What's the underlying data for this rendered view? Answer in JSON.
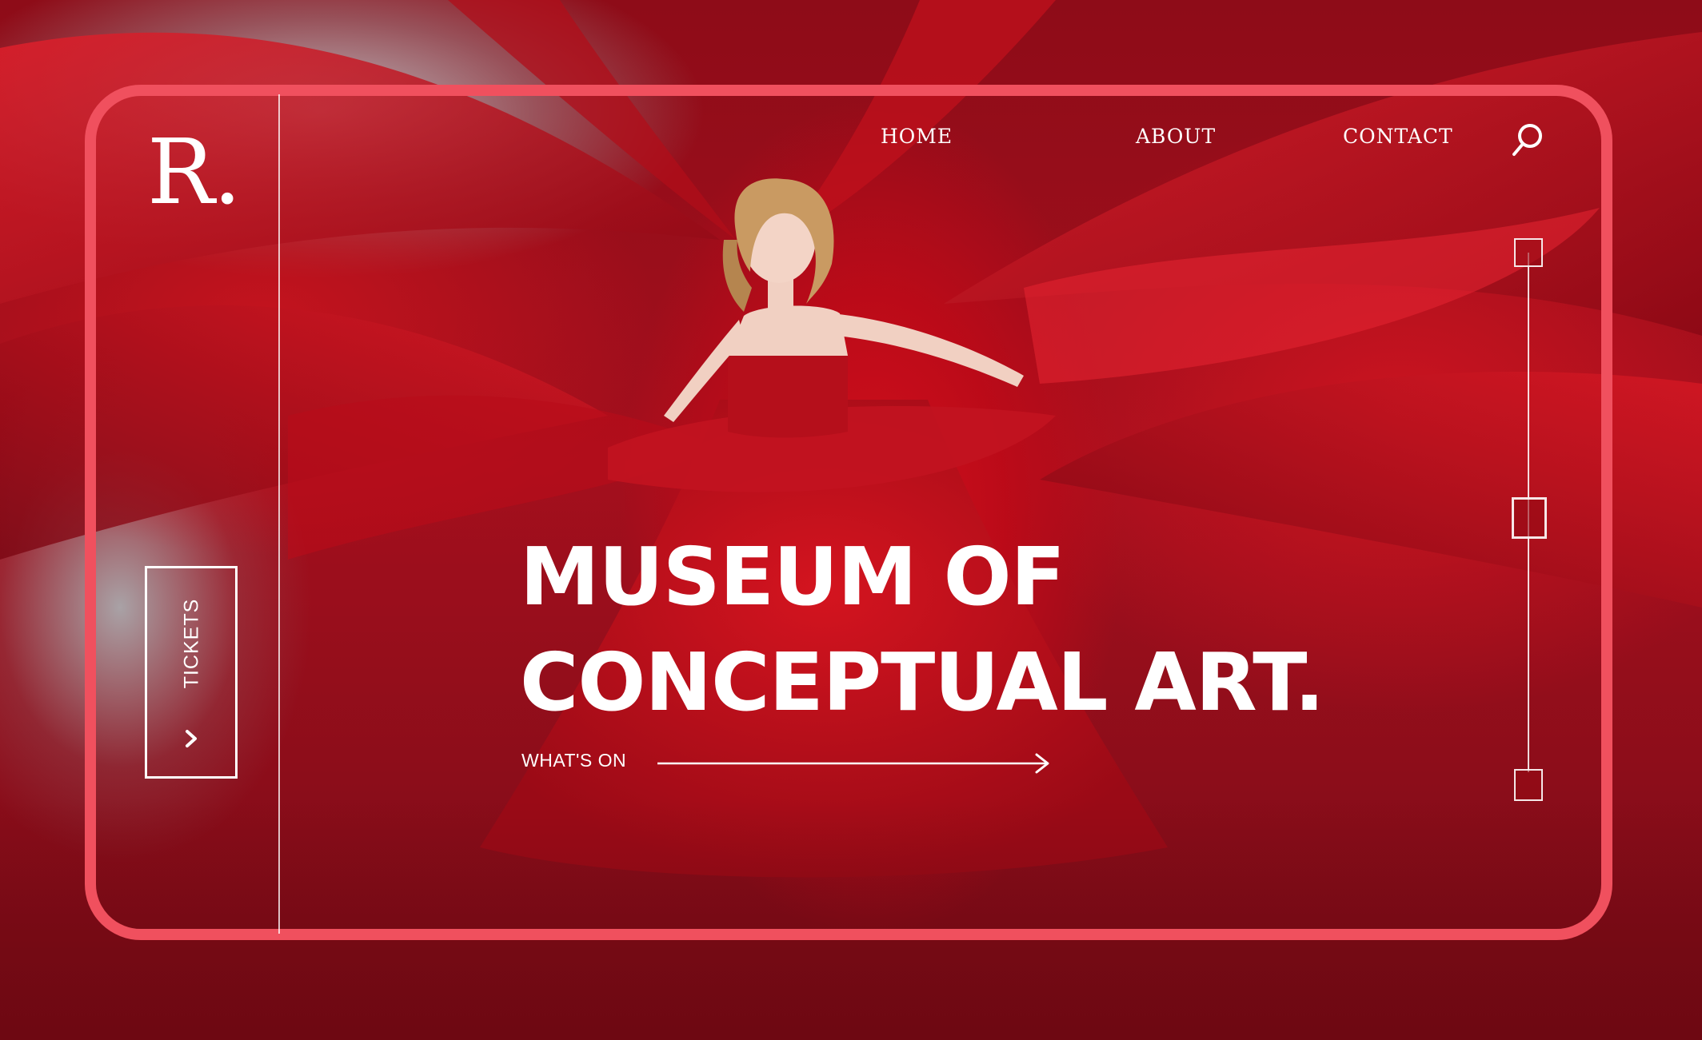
{
  "brand": {
    "logo": "R."
  },
  "nav": {
    "items": [
      "HOME",
      "ABOUT",
      "CONTACT"
    ],
    "search_icon": "search-icon"
  },
  "tickets": {
    "label": "TICKETS",
    "icon": "chevron-right-icon"
  },
  "hero": {
    "title_line1": "MUSEUM OF",
    "title_line2": "CONCEPTUAL ART.",
    "cta_label": "WHAT'S ON",
    "cta_icon": "arrow-right-icon"
  },
  "slider": {
    "count": 3,
    "active_index": 1
  },
  "colors": {
    "frame": "#f0505e",
    "accent_red": "#c8101e",
    "text": "#ffffff"
  }
}
